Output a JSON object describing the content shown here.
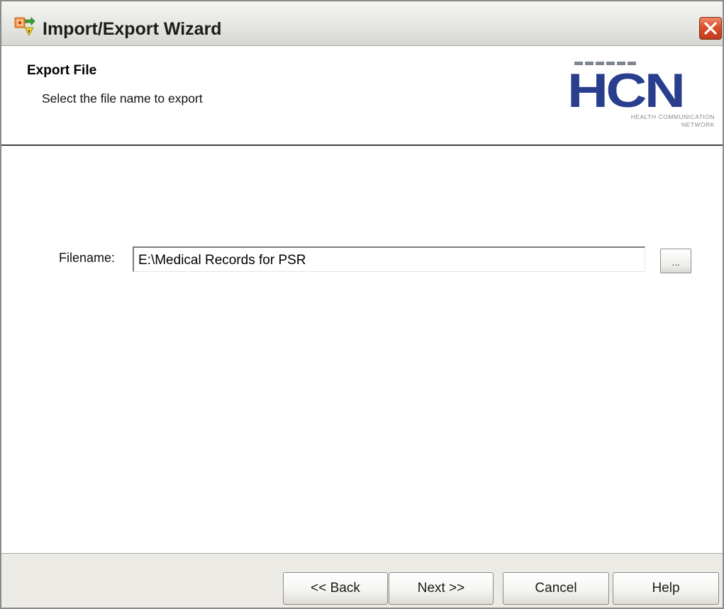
{
  "window": {
    "title": "Import/Export Wizard",
    "app_icon": "import-export-icon",
    "close_icon": "close-icon"
  },
  "header": {
    "title": "Export File",
    "subtitle": "Select the file name to export",
    "logo": {
      "letters": "HCN",
      "tagline_line1": "HEALTH COMMUNICATION",
      "tagline_line2": "NETWORK"
    }
  },
  "form": {
    "filename_label": "Filename:",
    "filename_value": "E:\\Medical Records for PSR",
    "browse_label": "..."
  },
  "footer": {
    "back_label": "<< Back",
    "next_label": "Next >>",
    "cancel_label": "Cancel",
    "help_label": "Help"
  },
  "colors": {
    "logo_blue": "#2a3e8e",
    "close_red": "#d9502d",
    "footer_bg": "#ecebe6"
  }
}
